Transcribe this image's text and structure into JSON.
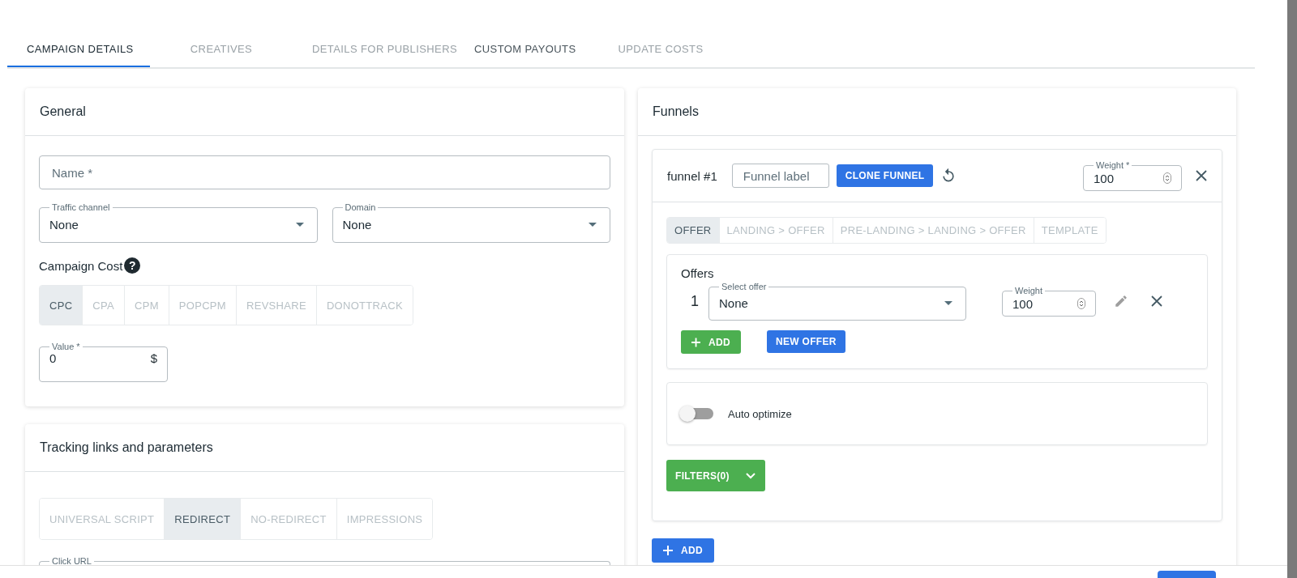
{
  "tabs": [
    {
      "label": "CAMPAIGN DETAILS",
      "selected": true,
      "disabled": false
    },
    {
      "label": "CREATIVES",
      "selected": false,
      "disabled": true
    },
    {
      "label": "DETAILS FOR PUBLISHERS",
      "selected": false,
      "disabled": true
    },
    {
      "label": "CUSTOM PAYOUTS",
      "selected": false,
      "disabled": false
    },
    {
      "label": "UPDATE COSTS",
      "selected": false,
      "disabled": true
    }
  ],
  "general": {
    "title": "General",
    "name_field": {
      "placeholder": "Name *"
    },
    "traffic_channel": {
      "label": "Traffic channel",
      "value": "None"
    },
    "domain": {
      "label": "Domain",
      "value": "None"
    },
    "campaign_cost": {
      "label": "Campaign Cost",
      "help": "?"
    },
    "cost_models": [
      {
        "label": "CPC",
        "selected": true
      },
      {
        "label": "CPA",
        "selected": false
      },
      {
        "label": "CPM",
        "selected": false
      },
      {
        "label": "POPCPM",
        "selected": false
      },
      {
        "label": "REVSHARE",
        "selected": false
      },
      {
        "label": "DONOTTRACK",
        "selected": false
      }
    ],
    "value_field": {
      "label": "Value *",
      "value": "0",
      "suffix": "$"
    }
  },
  "tracking": {
    "title": "Tracking links and parameters",
    "modes": [
      {
        "label": "UNIVERSAL SCRIPT",
        "selected": false
      },
      {
        "label": "REDIRECT",
        "selected": true
      },
      {
        "label": "NO-REDIRECT",
        "selected": false
      },
      {
        "label": "IMPRESSIONS",
        "selected": false
      }
    ],
    "click_url": {
      "label": "Click URL"
    }
  },
  "funnels": {
    "title": "Funnels",
    "funnel": {
      "name": "funnel #1",
      "label_field": {
        "placeholder": "Funnel label"
      },
      "clone_button": "CLONE FUNNEL",
      "weight": {
        "label": "Weight *",
        "value": "100"
      },
      "flow_types": [
        {
          "label": "OFFER",
          "selected": true
        },
        {
          "label": "LANDING > OFFER",
          "selected": false
        },
        {
          "label": "PRE-LANDING > LANDING > OFFER",
          "selected": false
        },
        {
          "label": "TEMPLATE",
          "selected": false
        }
      ],
      "offers": {
        "title": "Offers",
        "rows": [
          {
            "index": "1",
            "select": {
              "label": "Select offer",
              "value": "None"
            },
            "weight": {
              "label": "Weight",
              "value": "100"
            }
          }
        ],
        "add_button": "ADD",
        "new_offer_button": "NEW OFFER"
      },
      "auto_optimize": {
        "label": "Auto optimize",
        "on": false
      },
      "filters_button": "FILTERS(0)"
    },
    "add_button": "ADD"
  }
}
